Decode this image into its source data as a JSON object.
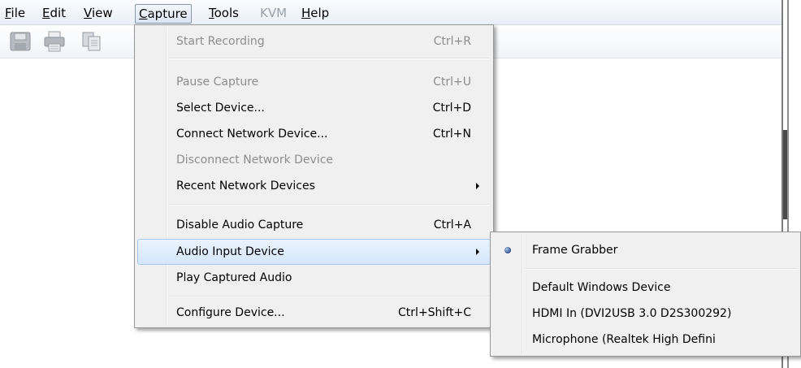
{
  "menubar": {
    "items": [
      {
        "label": "File",
        "accel": "F",
        "rest": "ile"
      },
      {
        "label": "Edit",
        "accel": "E",
        "rest": "dit"
      },
      {
        "label": "View",
        "accel": "V",
        "rest": "iew"
      },
      {
        "label": "Capture",
        "accel": "C",
        "rest": "apture"
      },
      {
        "label": "Tools",
        "accel": "T",
        "rest": "ools"
      },
      {
        "label": "KVM"
      },
      {
        "label": "Help",
        "accel": "H",
        "rest": "elp"
      }
    ]
  },
  "toolbar": {
    "icons": [
      "save-icon",
      "print-icon",
      "copy-icon"
    ]
  },
  "capture_menu": {
    "items": [
      {
        "label": "Start Recording",
        "shortcut": "Ctrl+R",
        "disabled": true
      },
      {
        "label": "Pause Capture",
        "shortcut": "Ctrl+U",
        "disabled": true
      },
      {
        "label": "Select Device...",
        "shortcut": "Ctrl+D",
        "disabled": false
      },
      {
        "label": "Connect Network Device...",
        "shortcut": "Ctrl+N",
        "disabled": false
      },
      {
        "label": "Disconnect Network Device",
        "shortcut": "",
        "disabled": true
      },
      {
        "label": "Recent Network Devices",
        "shortcut": "",
        "disabled": false,
        "submenu": true
      },
      {
        "label": "Disable Audio Capture",
        "shortcut": "Ctrl+A",
        "disabled": false
      },
      {
        "label": "Audio Input Device",
        "shortcut": "",
        "disabled": false,
        "submenu": true,
        "highlighted": true
      },
      {
        "label": "Play Captured Audio",
        "shortcut": "",
        "disabled": false
      },
      {
        "label": "Configure Device...",
        "shortcut": "Ctrl+Shift+C",
        "disabled": false
      }
    ]
  },
  "audio_submenu": {
    "items": [
      {
        "label": "Frame Grabber",
        "selected": true
      },
      {
        "label": "Default Windows Device",
        "selected": false
      },
      {
        "label": "HDMI In (DVI2USB 3.0 D2S300292)",
        "selected": false
      },
      {
        "label": "Microphone (Realtek High Defini",
        "selected": false
      }
    ]
  },
  "colors": {
    "highlight": "#d5e6fb",
    "menu_bg": "#f0f0f0",
    "disabled_text": "#8d8d8d"
  }
}
